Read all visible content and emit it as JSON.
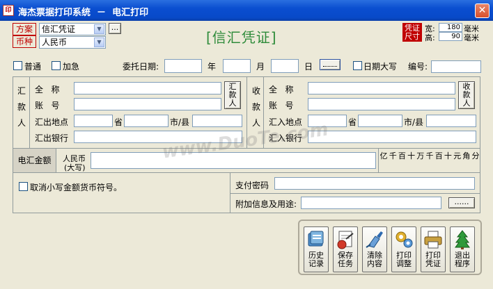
{
  "window": {
    "title": "海杰票据打印系统  －  电汇打印",
    "app_icon": "印"
  },
  "scheme": {
    "label": "方案",
    "value": "信汇凭证",
    "browse": "..."
  },
  "currency": {
    "label": "币种",
    "value": "人民币"
  },
  "doc_title": "[信汇凭证]",
  "size": {
    "label1": "凭证",
    "label2": "尺寸",
    "width_label": "宽:",
    "width_value": "180",
    "height_label": "高:",
    "height_value": "90",
    "unit": "毫米"
  },
  "options": {
    "normal": "普通",
    "urgent": "加急",
    "date_label": "委托日期:",
    "year": "年",
    "month": "月",
    "day": "日",
    "date_btn": "",
    "date_upper": "日期大写",
    "number_label": "编号:"
  },
  "remitter": {
    "side": [
      "汇",
      "款",
      "人"
    ],
    "name_label": "全   称",
    "account_label": "账   号",
    "location_label": "汇出地点",
    "province": "省",
    "city": "市/县",
    "bank_label": "汇出银行",
    "pick_btn": "汇\n款\n人"
  },
  "payee": {
    "side": [
      "收",
      "款",
      "人"
    ],
    "name_label": "全   称",
    "account_label": "账   号",
    "location_label": "汇入地点",
    "province": "省",
    "city": "市/县",
    "bank_label": "汇入银行",
    "pick_btn": "收\n款\n人"
  },
  "amount": {
    "label": "电汇金额",
    "rmb_label": "人民币",
    "rmb_label2": "(大写)",
    "digits": [
      "亿",
      "千",
      "百",
      "十",
      "万",
      "千",
      "百",
      "十",
      "元",
      "角",
      "分"
    ]
  },
  "cancel_symbol": "取消小写金额货币符号。",
  "pay_password_label": "支付密码",
  "extra_info_label": "附加信息及用途:",
  "extra_btn": "......",
  "toolbar": [
    {
      "l1": "历史",
      "l2": "记录",
      "icon": "history-icon"
    },
    {
      "l1": "保存",
      "l2": "任务",
      "icon": "save-task-icon"
    },
    {
      "l1": "清除",
      "l2": "内容",
      "icon": "clear-icon"
    },
    {
      "l1": "打印",
      "l2": "调整",
      "icon": "print-adjust-icon"
    },
    {
      "l1": "打印",
      "l2": "凭证",
      "icon": "printer-icon"
    },
    {
      "l1": "退出",
      "l2": "程序",
      "icon": "exit-tree-icon"
    }
  ],
  "watermark": "www.DuoTe.com"
}
